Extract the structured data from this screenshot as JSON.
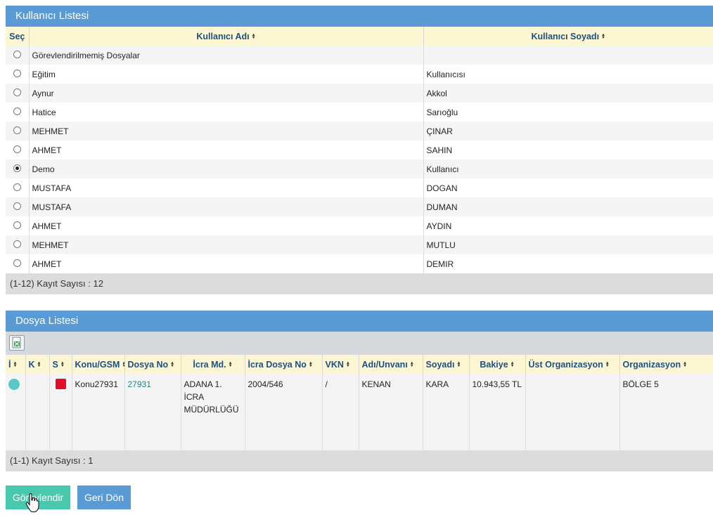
{
  "users_panel": {
    "title": "Kullanıcı Listesi",
    "columns": {
      "select": "Seç",
      "first_name": "Kullanıcı Adı",
      "last_name": "Kullanıcı Soyadı"
    },
    "rows": [
      {
        "first_name": "Görevlendirilmemiş Dosyalar",
        "last_name": "",
        "selected": false
      },
      {
        "first_name": "Eğitim",
        "last_name": "Kullanıcısı",
        "selected": false
      },
      {
        "first_name": "Aynur",
        "last_name": "Akkol",
        "selected": false
      },
      {
        "first_name": "Hatice",
        "last_name": "Sarıoğlu",
        "selected": false
      },
      {
        "first_name": "MEHMET",
        "last_name": "ÇINAR",
        "selected": false
      },
      {
        "first_name": "AHMET",
        "last_name": "SAHIN",
        "selected": false
      },
      {
        "first_name": "Demo",
        "last_name": "Kullanıcı",
        "selected": true
      },
      {
        "first_name": "MUSTAFA",
        "last_name": "DOGAN",
        "selected": false
      },
      {
        "first_name": "MUSTAFA",
        "last_name": "DUMAN",
        "selected": false
      },
      {
        "first_name": "AHMET",
        "last_name": "AYDIN",
        "selected": false
      },
      {
        "first_name": "MEHMET",
        "last_name": "MUTLU",
        "selected": false
      },
      {
        "first_name": "AHMET",
        "last_name": "DEMIR",
        "selected": false
      }
    ],
    "footer": "(1-12) Kayıt Sayısı : 12"
  },
  "files_panel": {
    "title": "Dosya Listesi",
    "columns": {
      "i": "İ",
      "k": "K",
      "s": "S",
      "konu": "Konu/GSM",
      "dosya_no": "Dosya No",
      "icra_md": "İcra Md.",
      "icra_dosya_no": "İcra Dosya No",
      "vkn": "VKN",
      "adi": "Adı/Unvanı",
      "soyadi": "Soyadı",
      "bakiye": "Bakiye",
      "ust_org": "Üst Organizasyon",
      "org": "Organizasyon"
    },
    "rows": [
      {
        "konu": "Konu27931",
        "dosya_no": "27931",
        "icra_md": "ADANA 1. İCRA MÜDÜRLÜĞÜ",
        "icra_dosya_no": "2004/546",
        "vkn": "/",
        "adi": "KENAN",
        "soyadi": "KARA",
        "bakiye": "10.943,55 TL",
        "ust_org": "",
        "org": "BÖLGE 5",
        "status_color": "#5bc8c8",
        "flag_color": "#e0102a"
      }
    ],
    "footer": "(1-1) Kayıt Sayısı : 1"
  },
  "buttons": {
    "assign": "Görevlendir",
    "back": "Geri Dön"
  },
  "icons": {
    "sort": "sort-arrows-icon",
    "excel": "excel-export-icon",
    "cursor": "hand-pointer-icon"
  },
  "colors": {
    "header_blue": "#5b9bd5",
    "assign_green": "#48c8ad",
    "column_header_bg": "#fdf6d2"
  }
}
